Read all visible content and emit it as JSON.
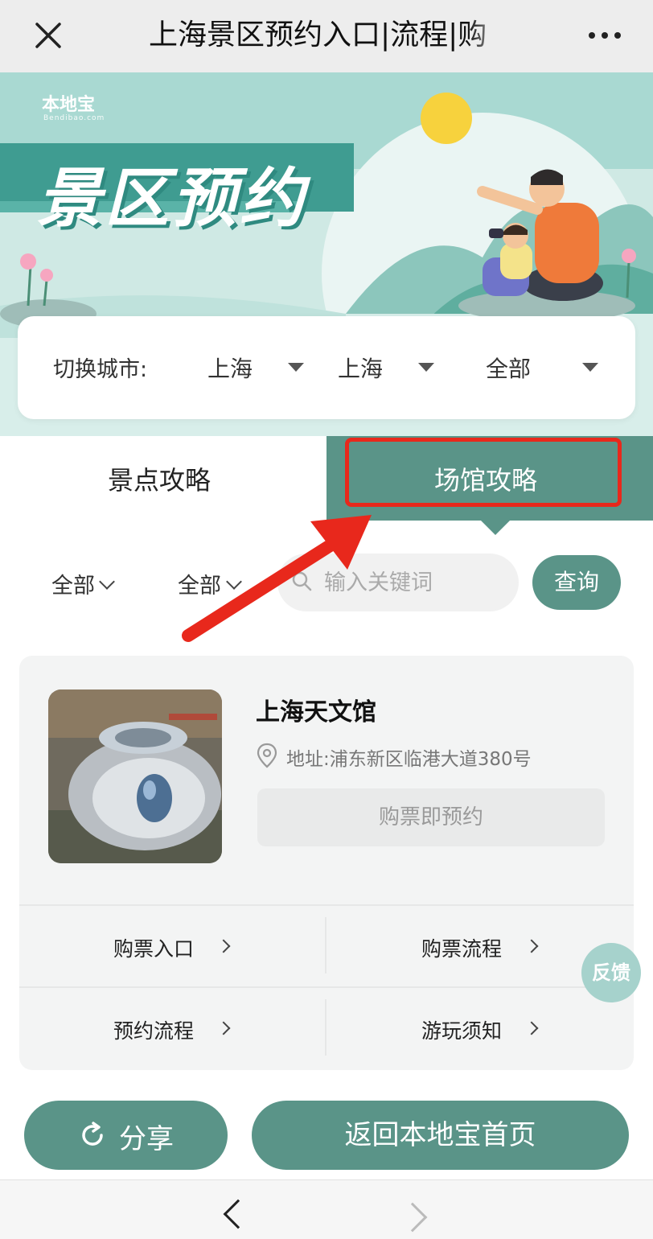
{
  "topbar": {
    "title": "上海景区预约入口|流程|购"
  },
  "banner": {
    "logo": "本地宝",
    "logo_sub": "Bendibao.com",
    "title": "景区预约"
  },
  "city_selector": {
    "label": "切换城市:",
    "province": "上海",
    "city": "上海",
    "district": "全部"
  },
  "tabs": {
    "left": "景点攻略",
    "right": "场馆攻略"
  },
  "filters": {
    "filter1": "全部",
    "filter2": "全部",
    "search_placeholder": "输入关键词",
    "query_button": "查询"
  },
  "venue": {
    "name": "上海天文馆",
    "address": "地址:浦东新区临港大道380号",
    "buy_button": "购票即预约",
    "links": [
      "购票入口",
      "购票流程",
      "预约流程",
      "游玩须知"
    ]
  },
  "feedback": "反馈",
  "bottom": {
    "share": "分享",
    "home": "返回本地宝首页"
  },
  "colors": {
    "accent": "#5a9488",
    "highlight": "#e8281c",
    "arrow": "#e8281c"
  }
}
